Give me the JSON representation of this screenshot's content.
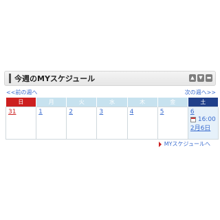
{
  "widget": {
    "title": "今週のMYスケジュール",
    "controls": [
      "move-up",
      "move-down",
      "minimize"
    ]
  },
  "nav": {
    "prev_label": "<<前の週へ",
    "next_label": "次の週へ>>"
  },
  "calendar": {
    "days": [
      {
        "label": "日",
        "date": "31",
        "type": "sun"
      },
      {
        "label": "月",
        "date": "1",
        "type": "weekday"
      },
      {
        "label": "火",
        "date": "2",
        "type": "weekday"
      },
      {
        "label": "水",
        "date": "3",
        "type": "weekday"
      },
      {
        "label": "木",
        "date": "4",
        "type": "weekday"
      },
      {
        "label": "金",
        "date": "5",
        "type": "weekday"
      },
      {
        "label": "土",
        "date": "6",
        "type": "sat"
      }
    ],
    "event": {
      "time": "16:00",
      "date": "2月6日"
    }
  },
  "footer": {
    "link_label": "MYスケジュールへ"
  },
  "colors": {
    "sun_header": "#cc1f1f",
    "sat_header": "#1f3f8a",
    "weekday_header": "#c7e2ef",
    "link": "#3a6ccf"
  }
}
